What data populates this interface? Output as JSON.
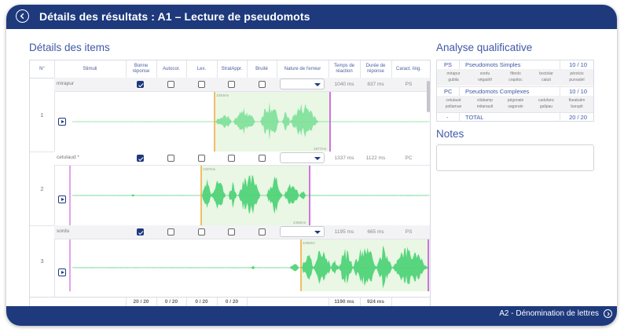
{
  "header": {
    "title": "Détails des résultats : A1 – Lecture de pseudomots"
  },
  "footer": {
    "next_label": "A2 - Dénomination de lettres"
  },
  "items": {
    "heading": "Détails des items",
    "columns": [
      "N°",
      "Stimuli",
      "Bonne réponse",
      "Autocor.",
      "Lex.",
      "StratAppr.",
      "Bruité",
      "Nature de l'erreur",
      "Temps de réaction",
      "Durée de réponse",
      "Caract. ling."
    ],
    "rows": [
      {
        "num": "1",
        "stimulus": "mirapur",
        "bonne": true,
        "autocor": false,
        "lex": false,
        "strat": false,
        "bruite": false,
        "temps": "1040 ms",
        "duree": "837 ms",
        "caract": "PS",
        "marker_start": "1040ms",
        "marker_end": "1877ms"
      },
      {
        "num": "2",
        "stimulus": "cetulaud *",
        "bonne": true,
        "autocor": false,
        "lex": false,
        "strat": false,
        "bruite": false,
        "temps": "1337 ms",
        "duree": "1122 ms",
        "caract": "PC",
        "marker_start": "1337ms",
        "marker_end": "2459ms"
      },
      {
        "num": "3",
        "stimulus": "sordu",
        "bonne": true,
        "autocor": false,
        "lex": false,
        "strat": false,
        "bruite": false,
        "temps": "1195 ms",
        "duree": "665 ms",
        "caract": "PS",
        "marker_start": "1195ms",
        "marker_end": ""
      }
    ],
    "totals": {
      "bonne": "20 / 20",
      "autocor": "0 / 20",
      "lex": "0 / 20",
      "strat": "0 / 20",
      "temps": "1190 ms",
      "duree": "924 ms"
    }
  },
  "analyse": {
    "heading": "Analyse qualificative",
    "groups": [
      {
        "code": "PS",
        "label": "Pseudomots Simples",
        "score": "10 / 10",
        "words": [
          "mirapur",
          "sordu",
          "fibrolo",
          "boctolar",
          "pérolcis",
          "gubila",
          "végadrif",
          "crapitoc",
          "caluti",
          "purvadel"
        ]
      },
      {
        "code": "PC",
        "label": "Pseudomots Complexes",
        "score": "10 / 10",
        "words": [
          "cetulaud",
          "vilubamp",
          "pégonale",
          "cadufanc",
          "flarabalm",
          "poltamue",
          "mitanault",
          "sagorain",
          "galipau",
          "barupit"
        ]
      }
    ],
    "total": {
      "code": "-",
      "label": "TOTAL",
      "score": "20 / 20"
    }
  },
  "notes": {
    "heading": "Notes",
    "value": ""
  },
  "colors": {
    "primary": "#1e3a7d",
    "wave": "#5dd882",
    "highlight": "#e9f7e4",
    "start_marker": "#f5a53a",
    "end_marker": "#c447d6"
  },
  "icons": {
    "back": "arrow-left-circle-icon",
    "next": "arrow-right-circle-icon",
    "play": "play-icon",
    "dropdown": "chevron-down-icon",
    "check": "check-icon"
  }
}
